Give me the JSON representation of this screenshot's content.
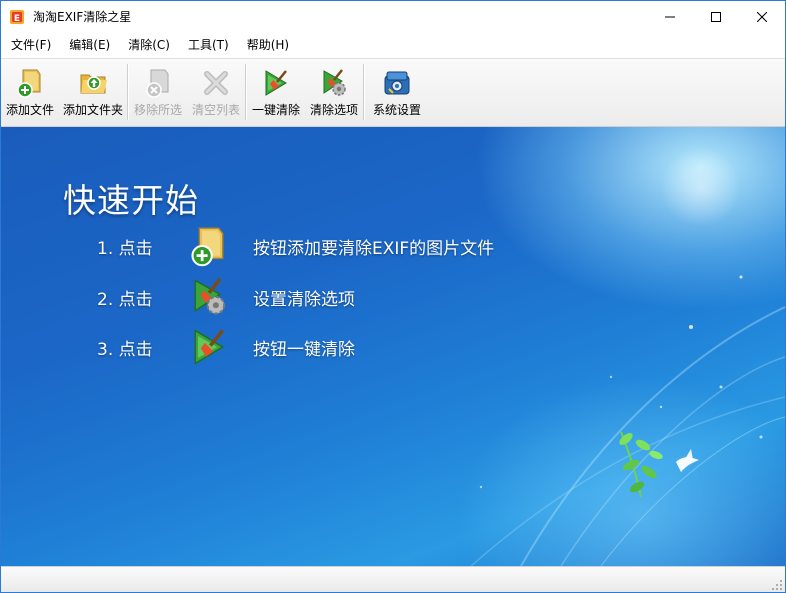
{
  "window": {
    "title": "淘淘EXIF清除之星"
  },
  "menu": {
    "items": [
      {
        "label": "文件(F)"
      },
      {
        "label": "编辑(E)"
      },
      {
        "label": "清除(C)"
      },
      {
        "label": "工具(T)"
      },
      {
        "label": "帮助(H)"
      }
    ]
  },
  "toolbar": {
    "add_file": "添加文件",
    "add_folder": "添加文件夹",
    "remove_selected": "移除所选",
    "clear_list": "清空列表",
    "one_click_clean": "一键清除",
    "clean_options": "清除选项",
    "system_settings": "系统设置"
  },
  "quickstart": {
    "title": "快速开始",
    "steps": [
      {
        "num": "1. 点击",
        "text": "按钮添加要清除EXIF的图片文件"
      },
      {
        "num": "2. 点击",
        "text": "设置清除选项"
      },
      {
        "num": "3. 点击",
        "text": "按钮一键清除"
      }
    ]
  },
  "colors": {
    "accent": "#1b67c7",
    "titlebar_border": "#2b7bd6",
    "disabled_text": "#a8a8a8"
  }
}
